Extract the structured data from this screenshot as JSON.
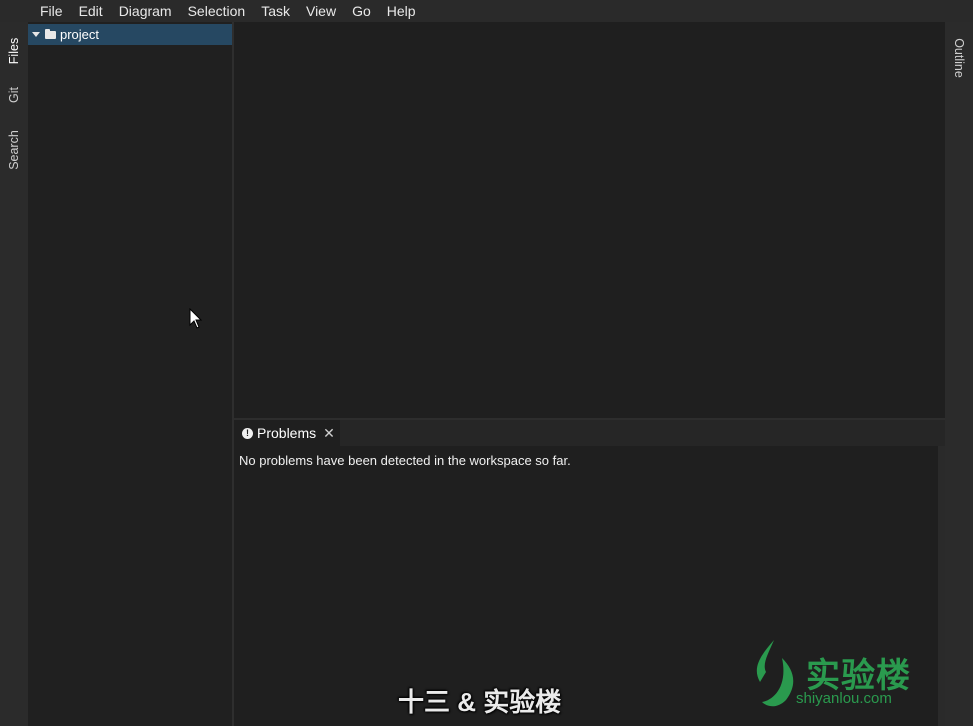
{
  "menu": [
    "File",
    "Edit",
    "Diagram",
    "Selection",
    "Task",
    "View",
    "Go",
    "Help"
  ],
  "left_rail": {
    "tabs": [
      "Files",
      "Git",
      "Search"
    ],
    "active": "Files"
  },
  "right_rail": {
    "tabs": [
      "Outline"
    ]
  },
  "files": {
    "root": {
      "label": "project",
      "expanded": true,
      "selected": true
    }
  },
  "bottom_panel": {
    "tab_label": "Problems",
    "message": "No problems have been detected in the workspace so far."
  },
  "watermark": {
    "name": "实验楼",
    "url": "shiyanlou.com",
    "color": "#2a9a4e"
  },
  "caption": "十三 & 实验楼",
  "colors": {
    "selection": "#264862",
    "background": "#1f1f1f",
    "chrome": "#2b2b2b"
  }
}
